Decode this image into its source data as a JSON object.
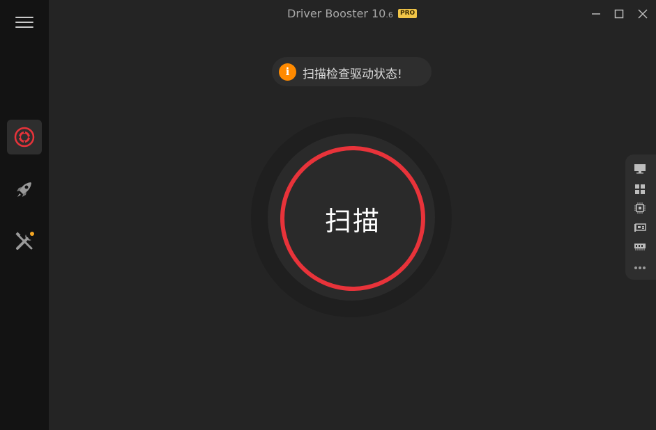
{
  "window": {
    "title": "Driver Booster 10",
    "version_sub": ".6",
    "badge": "PRO"
  },
  "sidebar": {
    "items": [
      {
        "name": "scan",
        "icon": "scan-target-icon",
        "active": true
      },
      {
        "name": "boost",
        "icon": "rocket-icon",
        "active": false
      },
      {
        "name": "tools",
        "icon": "tools-icon",
        "active": false,
        "notification_dot": true
      }
    ]
  },
  "banner": {
    "icon_glyph": "i",
    "text": "扫描检查驱动状态!"
  },
  "scan": {
    "label": "扫描"
  },
  "right_panel": {
    "items": [
      {
        "icon": "monitor-icon"
      },
      {
        "icon": "windows-icon"
      },
      {
        "icon": "cpu-icon"
      },
      {
        "icon": "network-card-icon"
      },
      {
        "icon": "memory-icon"
      },
      {
        "icon": "more-icon"
      }
    ]
  },
  "colors": {
    "accent_red": "#e8333a",
    "info_orange": "#ff8a00",
    "pro_gold": "#f0c447",
    "notify_dot": "#f5a623"
  }
}
